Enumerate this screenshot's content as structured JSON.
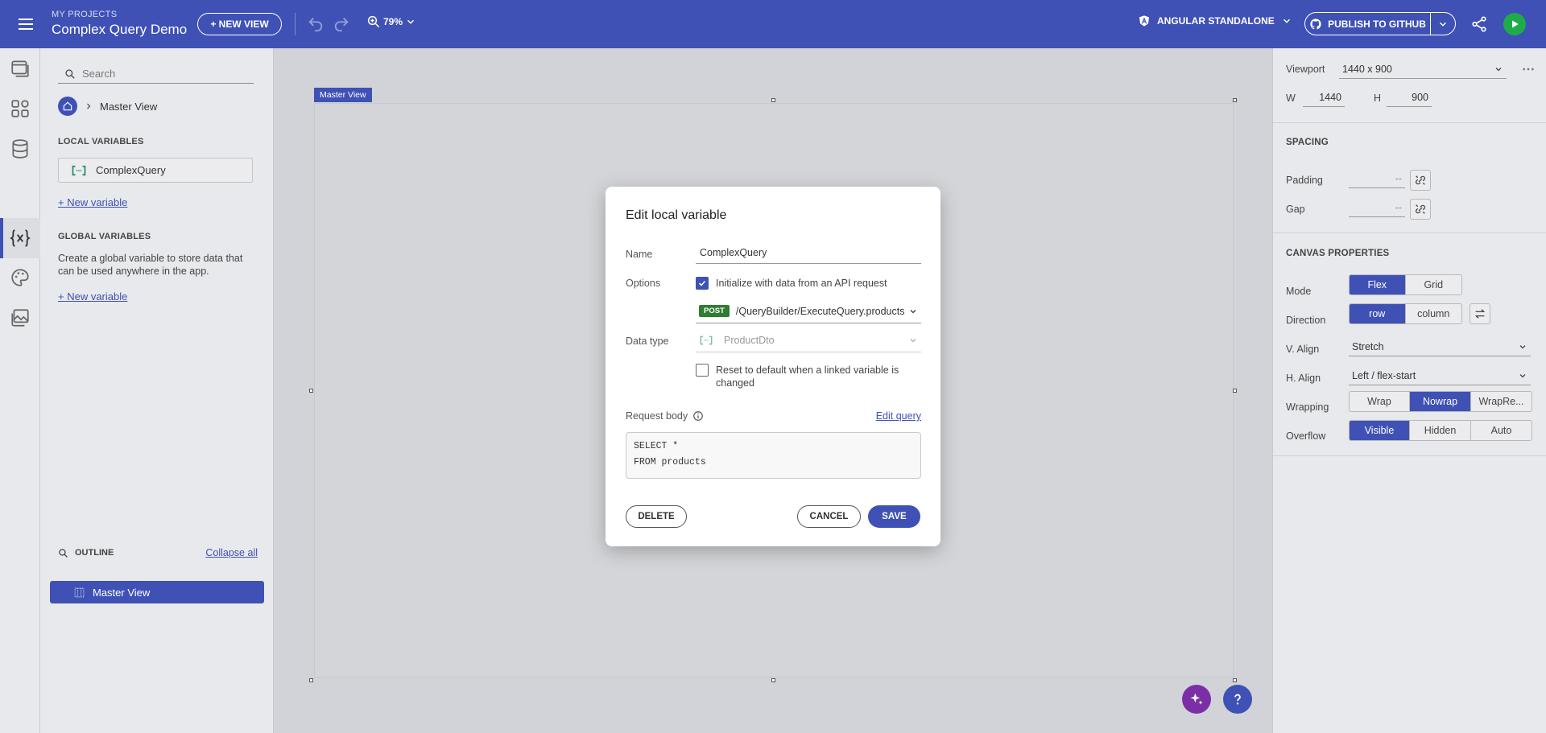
{
  "topbar": {
    "project_label": "MY PROJECTS",
    "project_title": "Complex Query Demo",
    "new_view": "+ NEW VIEW",
    "zoom": "79%",
    "framework": "ANGULAR STANDALONE",
    "publish": "PUBLISH TO GITHUB"
  },
  "left": {
    "search_placeholder": "Search",
    "breadcrumb": "Master View",
    "local_title": "LOCAL VARIABLES",
    "local_var": "ComplexQuery",
    "new_variable": "+ New variable",
    "global_title": "GLOBAL VARIABLES",
    "global_desc": "Create a global variable to store data that can be used anywhere in the app.",
    "outline_title": "OUTLINE",
    "collapse_all": "Collapse all",
    "outline_item": "Master View"
  },
  "canvas": {
    "tag": "Master View"
  },
  "right": {
    "viewport_label": "Viewport",
    "viewport_value": "1440 x 900",
    "w_label": "W",
    "w_value": "1440",
    "h_label": "H",
    "h_value": "900",
    "spacing_title": "SPACING",
    "padding_label": "Padding",
    "padding_value": "--",
    "gap_label": "Gap",
    "gap_value": "--",
    "canvas_title": "CANVAS PROPERTIES",
    "mode_label": "Mode",
    "mode_options": [
      "Flex",
      "Grid"
    ],
    "direction_label": "Direction",
    "direction_options": [
      "row",
      "column"
    ],
    "valign_label": "V. Align",
    "valign_value": "Stretch",
    "halign_label": "H. Align",
    "halign_value": "Left / flex-start",
    "wrapping_label": "Wrapping",
    "wrapping_options": [
      "Wrap",
      "Nowrap",
      "WrapRe..."
    ],
    "overflow_label": "Overflow",
    "overflow_options": [
      "Visible",
      "Hidden",
      "Auto"
    ]
  },
  "modal": {
    "title": "Edit local variable",
    "name_label": "Name",
    "name_value": "ComplexQuery",
    "options_label": "Options",
    "init_option": "Initialize with data from an API request",
    "method": "POST",
    "endpoint": "/QueryBuilder/ExecuteQuery.products",
    "datatype_label": "Data type",
    "datatype_value": "ProductDto",
    "reset_option": "Reset to default when a linked variable is changed",
    "request_body_label": "Request body",
    "edit_query": "Edit query",
    "code_line1": "SELECT *",
    "code_line2": "FROM products",
    "delete": "DELETE",
    "cancel": "CANCEL",
    "save": "SAVE"
  },
  "colors": {
    "primary": "#3f51b5",
    "run": "#1eab4a",
    "post": "#2e7d32",
    "ai": "#7b2fa6"
  }
}
